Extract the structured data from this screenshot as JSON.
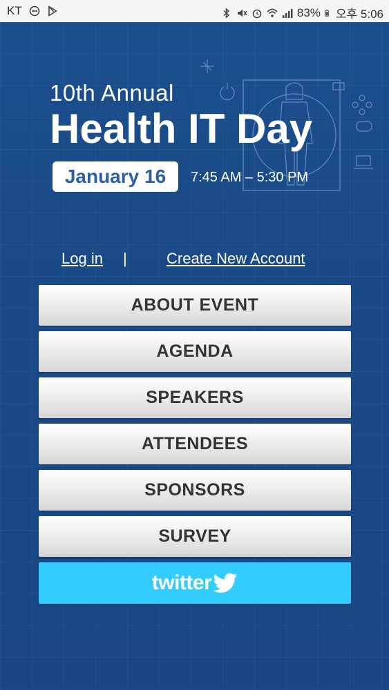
{
  "status_bar": {
    "carrier": "KT",
    "battery": "83%",
    "time": "오후 5:06"
  },
  "header": {
    "subtitle": "10th Annual",
    "title": "Health IT Day",
    "date": "January 16",
    "time_range": "7:45 AM – 5:30 PM"
  },
  "auth": {
    "login": "Log in",
    "separator": "|",
    "create_account": "Create New Account"
  },
  "menu": {
    "items": [
      {
        "label": "ABOUT EVENT"
      },
      {
        "label": "AGENDA"
      },
      {
        "label": "SPEAKERS"
      },
      {
        "label": "ATTENDEES"
      },
      {
        "label": "SPONSORS"
      },
      {
        "label": "SURVEY"
      }
    ],
    "twitter_label": "twitter"
  },
  "colors": {
    "background": "#1a4a86",
    "twitter": "#33ccff",
    "date_text": "#2b5fa8"
  }
}
